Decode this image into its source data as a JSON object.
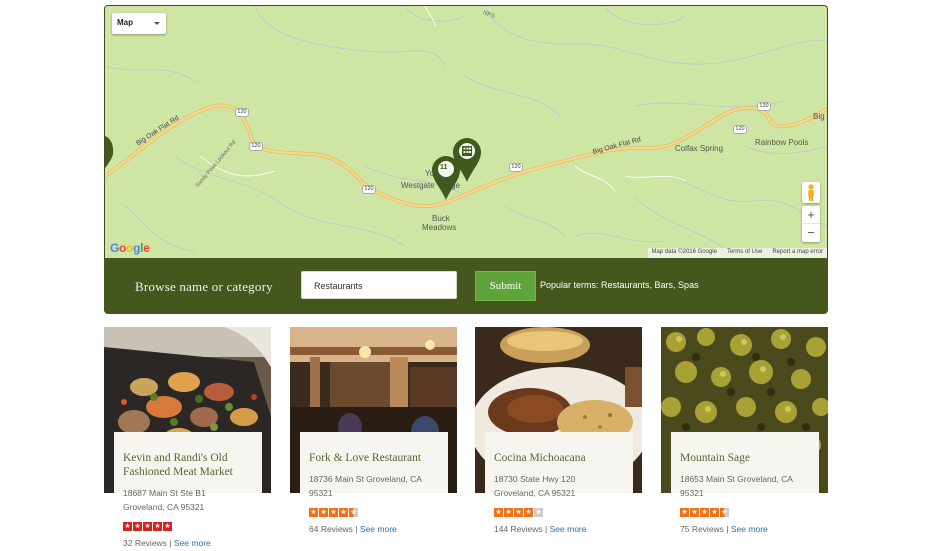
{
  "map": {
    "type_control": "Map",
    "google_logo": "Google",
    "footer": {
      "map_data": "Map data ©2016 Google",
      "terms": "Terms of Use",
      "report": "Report a map error"
    },
    "labels": {
      "westgate": "Westgate",
      "westgate_prefix": "Yo",
      "lodge_suffix": "ge",
      "buck_meadows_1": "Buck",
      "buck_meadows_2": "Meadows",
      "colfax_spring": "Colfax Spring",
      "rainbow_pools": "Rainbow Pools",
      "big_oak_flat_rd_left": "Big Oak Flat Rd",
      "big_oak_flat_rd_right": "Big Oak Flat Rd",
      "sandy_peak_rd": "Sandy Peak Lookout Rd",
      "big_right_edge": "Big",
      "top_road": "NPS"
    },
    "route_shields": [
      "120",
      "120",
      "120",
      "120",
      "120",
      "120"
    ],
    "cluster_marker_count": "11",
    "zoom_in": "+",
    "zoom_out": "−",
    "colors": {
      "land": "#cfe5a4",
      "road": "#f7cf73",
      "marker": "#3f5a1c"
    }
  },
  "search": {
    "label": "Browse name or category",
    "input_value": "Restaurants",
    "submit_label": "Submit",
    "popular_terms": "Popular terms: Restaurants, Bars, Spas"
  },
  "cards": [
    {
      "name": "Kevin and Randi's Old Fashioned Meat Market",
      "address_line1": "18687 Main St Ste B1",
      "address_line2": "Groveland, CA 95321",
      "rating": 5,
      "star_color": "#d32323",
      "reviews": "32 Reviews",
      "separator": "|",
      "see_more": "See more"
    },
    {
      "name": "Fork & Love Restaurant",
      "address_line1": "18736 Main St Groveland, CA",
      "address_line2": "95321",
      "rating": 4.5,
      "star_color": "#f2701a",
      "reviews": "64 Reviews",
      "separator": "|",
      "see_more": "See more"
    },
    {
      "name": "Cocina Michoacana",
      "address_line1": "18730 State Hwy 120",
      "address_line2": "Groveland, CA 95321",
      "rating": 4,
      "star_color": "#f2701a",
      "reviews": "144 Reviews",
      "separator": "|",
      "see_more": "See more"
    },
    {
      "name": "Mountain Sage",
      "address_line1": "18653 Main St Groveland, CA",
      "address_line2": "95321",
      "rating": 4.5,
      "star_color": "#f2701a",
      "reviews": "75 Reviews",
      "separator": "|",
      "see_more": "See more"
    }
  ]
}
